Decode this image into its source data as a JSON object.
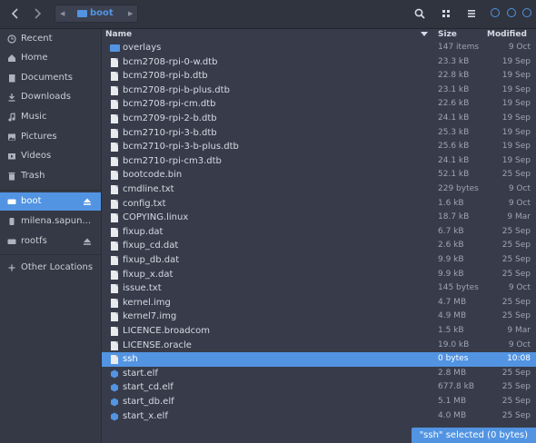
{
  "toolbar": {
    "back_icon": "chevron-left-icon",
    "forward_icon": "chevron-right-icon",
    "path_current": "boot",
    "path_left_icon": "caret-left-icon",
    "path_right_icon": "caret-right-icon",
    "search_icon": "search-icon",
    "view_icon": "grid-view-icon",
    "menu_icon": "hamburger-menu-icon"
  },
  "sidebar": {
    "places": [
      {
        "label": "Recent",
        "icon": "clock-icon"
      },
      {
        "label": "Home",
        "icon": "home-icon"
      },
      {
        "label": "Documents",
        "icon": "document-icon"
      },
      {
        "label": "Downloads",
        "icon": "download-icon"
      },
      {
        "label": "Music",
        "icon": "music-icon"
      },
      {
        "label": "Pictures",
        "icon": "picture-icon"
      },
      {
        "label": "Videos",
        "icon": "video-icon"
      },
      {
        "label": "Trash",
        "icon": "trash-icon"
      }
    ],
    "devices": [
      {
        "label": "boot",
        "icon": "drive-icon",
        "selected": true,
        "eject": true
      },
      {
        "label": "milena.sapun...",
        "icon": "usb-icon",
        "selected": false,
        "eject": false
      },
      {
        "label": "rootfs",
        "icon": "drive-icon",
        "selected": false,
        "eject": true
      }
    ],
    "other": {
      "label": "Other Locations",
      "icon": "plus-icon"
    }
  },
  "columns": {
    "name": "Name",
    "size": "Size",
    "modified": "Modified"
  },
  "files": [
    {
      "name": "overlays",
      "size": "147 items",
      "modified": "9 Oct",
      "type": "folder"
    },
    {
      "name": "bcm2708-rpi-0-w.dtb",
      "size": "23.3 kB",
      "modified": "19 Sep",
      "type": "file"
    },
    {
      "name": "bcm2708-rpi-b.dtb",
      "size": "22.8 kB",
      "modified": "19 Sep",
      "type": "file"
    },
    {
      "name": "bcm2708-rpi-b-plus.dtb",
      "size": "23.1 kB",
      "modified": "19 Sep",
      "type": "file"
    },
    {
      "name": "bcm2708-rpi-cm.dtb",
      "size": "22.6 kB",
      "modified": "19 Sep",
      "type": "file"
    },
    {
      "name": "bcm2709-rpi-2-b.dtb",
      "size": "24.1 kB",
      "modified": "19 Sep",
      "type": "file"
    },
    {
      "name": "bcm2710-rpi-3-b.dtb",
      "size": "25.3 kB",
      "modified": "19 Sep",
      "type": "file"
    },
    {
      "name": "bcm2710-rpi-3-b-plus.dtb",
      "size": "25.6 kB",
      "modified": "19 Sep",
      "type": "file"
    },
    {
      "name": "bcm2710-rpi-cm3.dtb",
      "size": "24.1 kB",
      "modified": "19 Sep",
      "type": "file"
    },
    {
      "name": "bootcode.bin",
      "size": "52.1 kB",
      "modified": "25 Sep",
      "type": "file"
    },
    {
      "name": "cmdline.txt",
      "size": "229 bytes",
      "modified": "9 Oct",
      "type": "file"
    },
    {
      "name": "config.txt",
      "size": "1.6 kB",
      "modified": "9 Oct",
      "type": "file"
    },
    {
      "name": "COPYING.linux",
      "size": "18.7 kB",
      "modified": "9 Mar",
      "type": "file"
    },
    {
      "name": "fixup.dat",
      "size": "6.7 kB",
      "modified": "25 Sep",
      "type": "file"
    },
    {
      "name": "fixup_cd.dat",
      "size": "2.6 kB",
      "modified": "25 Sep",
      "type": "file"
    },
    {
      "name": "fixup_db.dat",
      "size": "9.9 kB",
      "modified": "25 Sep",
      "type": "file"
    },
    {
      "name": "fixup_x.dat",
      "size": "9.9 kB",
      "modified": "25 Sep",
      "type": "file"
    },
    {
      "name": "issue.txt",
      "size": "145 bytes",
      "modified": "9 Oct",
      "type": "file"
    },
    {
      "name": "kernel.img",
      "size": "4.7 MB",
      "modified": "25 Sep",
      "type": "file"
    },
    {
      "name": "kernel7.img",
      "size": "4.9 MB",
      "modified": "25 Sep",
      "type": "file"
    },
    {
      "name": "LICENCE.broadcom",
      "size": "1.5 kB",
      "modified": "9 Mar",
      "type": "file"
    },
    {
      "name": "LICENSE.oracle",
      "size": "19.0 kB",
      "modified": "9 Oct",
      "type": "file"
    },
    {
      "name": "ssh",
      "size": "0 bytes",
      "modified": "10:08",
      "type": "file",
      "selected": true
    },
    {
      "name": "start.elf",
      "size": "2.8 MB",
      "modified": "25 Sep",
      "type": "binary"
    },
    {
      "name": "start_cd.elf",
      "size": "677.8 kB",
      "modified": "25 Sep",
      "type": "binary"
    },
    {
      "name": "start_db.elf",
      "size": "5.1 MB",
      "modified": "25 Sep",
      "type": "binary"
    },
    {
      "name": "start_x.elf",
      "size": "4.0 MB",
      "modified": "25 Sep",
      "type": "binary"
    }
  ],
  "status": {
    "text": "\"ssh\" selected  (0 bytes)"
  },
  "colors": {
    "accent": "#5294e2",
    "background": "#383c4a",
    "sidebar": "#353945",
    "header": "#2f343f"
  }
}
